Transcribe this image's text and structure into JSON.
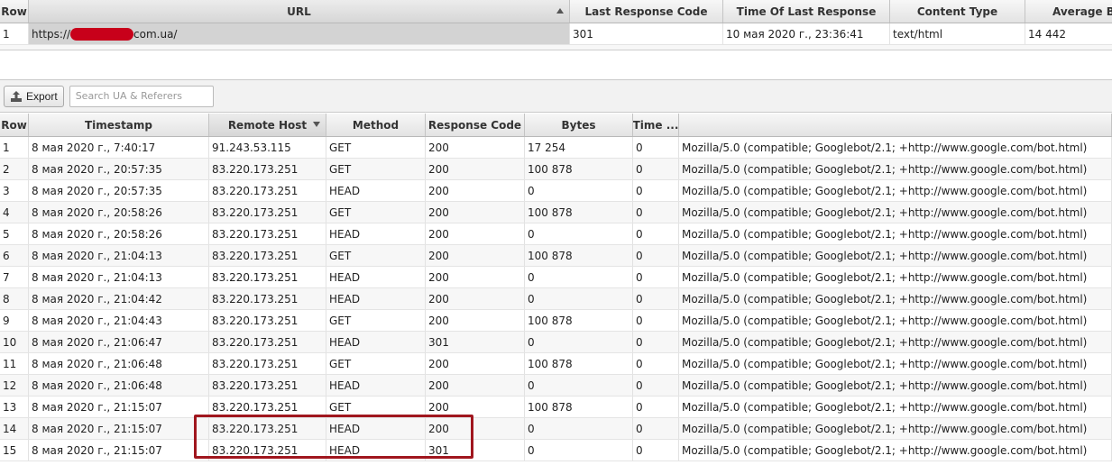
{
  "top_table": {
    "columns": [
      "Row",
      "URL",
      "Last Response Code",
      "Time Of Last Response",
      "Content Type",
      "Average Byt"
    ],
    "row": {
      "num": "1",
      "url_prefix": "https://",
      "url_suffix": "com.ua/",
      "code": "301",
      "time": "10 мая 2020 г., 23:36:41",
      "type": "text/html",
      "avg": "14 442"
    }
  },
  "toolbar": {
    "export_label": "Export",
    "search_placeholder": "Search UA & Referers"
  },
  "log_table": {
    "columns": [
      "Row",
      "Timestamp",
      "Remote Host",
      "Method",
      "Response Code",
      "Bytes",
      "Time ...",
      ""
    ],
    "rows": [
      [
        "1",
        "8 мая 2020 г., 7:40:17",
        "91.243.53.115",
        "GET",
        "200",
        "17 254",
        "0",
        "Mozilla/5.0 (compatible; Googlebot/2.1; +http://www.google.com/bot.html)"
      ],
      [
        "2",
        "8 мая 2020 г., 20:57:35",
        "83.220.173.251",
        "GET",
        "200",
        "100 878",
        "0",
        "Mozilla/5.0 (compatible; Googlebot/2.1; +http://www.google.com/bot.html)"
      ],
      [
        "3",
        "8 мая 2020 г., 20:57:35",
        "83.220.173.251",
        "HEAD",
        "200",
        "0",
        "0",
        "Mozilla/5.0 (compatible; Googlebot/2.1; +http://www.google.com/bot.html)"
      ],
      [
        "4",
        "8 мая 2020 г., 20:58:26",
        "83.220.173.251",
        "GET",
        "200",
        "100 878",
        "0",
        "Mozilla/5.0 (compatible; Googlebot/2.1; +http://www.google.com/bot.html)"
      ],
      [
        "5",
        "8 мая 2020 г., 20:58:26",
        "83.220.173.251",
        "HEAD",
        "200",
        "0",
        "0",
        "Mozilla/5.0 (compatible; Googlebot/2.1; +http://www.google.com/bot.html)"
      ],
      [
        "6",
        "8 мая 2020 г., 21:04:13",
        "83.220.173.251",
        "GET",
        "200",
        "100 878",
        "0",
        "Mozilla/5.0 (compatible; Googlebot/2.1; +http://www.google.com/bot.html)"
      ],
      [
        "7",
        "8 мая 2020 г., 21:04:13",
        "83.220.173.251",
        "HEAD",
        "200",
        "0",
        "0",
        "Mozilla/5.0 (compatible; Googlebot/2.1; +http://www.google.com/bot.html)"
      ],
      [
        "8",
        "8 мая 2020 г., 21:04:42",
        "83.220.173.251",
        "HEAD",
        "200",
        "0",
        "0",
        "Mozilla/5.0 (compatible; Googlebot/2.1; +http://www.google.com/bot.html)"
      ],
      [
        "9",
        "8 мая 2020 г., 21:04:43",
        "83.220.173.251",
        "GET",
        "200",
        "100 878",
        "0",
        "Mozilla/5.0 (compatible; Googlebot/2.1; +http://www.google.com/bot.html)"
      ],
      [
        "10",
        "8 мая 2020 г., 21:06:47",
        "83.220.173.251",
        "HEAD",
        "301",
        "0",
        "0",
        "Mozilla/5.0 (compatible; Googlebot/2.1; +http://www.google.com/bot.html)"
      ],
      [
        "11",
        "8 мая 2020 г., 21:06:48",
        "83.220.173.251",
        "GET",
        "200",
        "100 878",
        "0",
        "Mozilla/5.0 (compatible; Googlebot/2.1; +http://www.google.com/bot.html)"
      ],
      [
        "12",
        "8 мая 2020 г., 21:06:48",
        "83.220.173.251",
        "HEAD",
        "200",
        "0",
        "0",
        "Mozilla/5.0 (compatible; Googlebot/2.1; +http://www.google.com/bot.html)"
      ],
      [
        "13",
        "8 мая 2020 г., 21:15:07",
        "83.220.173.251",
        "GET",
        "200",
        "100 878",
        "0",
        "Mozilla/5.0 (compatible; Googlebot/2.1; +http://www.google.com/bot.html)"
      ],
      [
        "14",
        "8 мая 2020 г., 21:15:07",
        "83.220.173.251",
        "HEAD",
        "200",
        "0",
        "0",
        "Mozilla/5.0 (compatible; Googlebot/2.1; +http://www.google.com/bot.html)"
      ],
      [
        "15",
        "8 мая 2020 г., 21:15:07",
        "83.220.173.251",
        "HEAD",
        "301",
        "0",
        "0",
        "Mozilla/5.0 (compatible; Googlebot/2.1; +http://www.google.com/bot.html)"
      ]
    ]
  },
  "colors": {
    "highlight": "#a0161e",
    "redaction": "#c8001a"
  },
  "icons": {
    "export": "export-icon",
    "sort_url": "sort-ascending-icon",
    "sort_host": "sort-descending-icon"
  }
}
